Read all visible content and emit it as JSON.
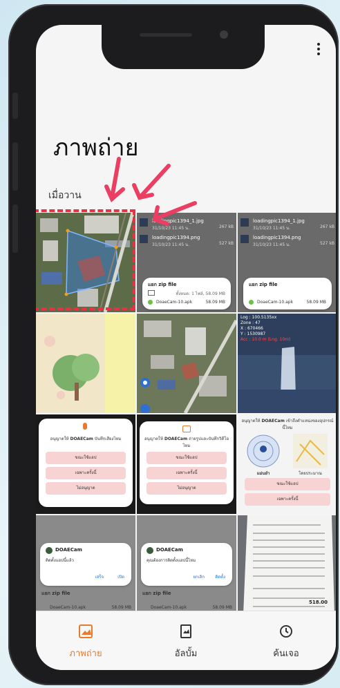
{
  "app": {
    "title": "ภาพถ่าย",
    "section_label": "เมื่อวาน",
    "accent_color": "#e87a2e",
    "highlight_color": "#e53345"
  },
  "grid": {
    "tile2": {
      "files": [
        {
          "name": "loadingpic1394_1.jpg",
          "date": "31/10/23 11:45 น.",
          "size": "267 kB"
        },
        {
          "name": "loadingpic1394.png",
          "date": "31/10/23 11:45 น.",
          "size": "527 kB"
        }
      ],
      "sheet_title": "แยก zip file",
      "sheet_meta": "ทั้งหมด: 1 ไฟล์, 58.09 MB",
      "apk_name": "DoaeCam-10.apk",
      "apk_size": "58.09 MB"
    },
    "tile3": {
      "files": [
        {
          "name": "loadingpic1394_1.jpg",
          "date": "31/10/23 11:45 น.",
          "size": "267 kB"
        },
        {
          "name": "loadingpic1394.png",
          "date": "31/10/23 11:45 น.",
          "size": "527 kB"
        }
      ],
      "sheet_title": "แยก zip file",
      "apk_name": "DoaeCam-10.apk",
      "apk_size": "58.09 MB"
    },
    "tile6": {
      "overlay_line1": "Log : 100.5135xx",
      "overlay_line2": "Zone : 47",
      "overlay_line3": "X : 670466",
      "overlay_line4": "Y : 1530987",
      "overlay_line5": "Acc : 10.0 m (Lng. 10m)"
    },
    "tile7": {
      "prompt_prefix": "อนุญาตให้",
      "prompt_app": "DOAECam",
      "prompt_suffix": "บันทึกเสียงไหม",
      "btn1": "ขณะใช้แอป",
      "btn2": "เฉพาะครั้งนี้",
      "btn3": "ไม่อนุญาต"
    },
    "tile8": {
      "prompt_prefix": "อนุญาตให้",
      "prompt_app": "DOAECam",
      "prompt_suffix": "ถ่ายรูปและบันทึกวิดีโอไหม",
      "btn1": "ขณะใช้แอป",
      "btn2": "เฉพาะครั้งนี้",
      "btn3": "ไม่อนุญาต"
    },
    "tile9": {
      "prompt_prefix": "อนุญาตให้",
      "prompt_app": "DOAECam",
      "prompt_suffix": "เข้าถึงตำแหน่งของอุปกรณ์นี้ไหม",
      "precise": "แม่นยำ",
      "approx": "โดยประมาณ",
      "btn1": "ขณะใช้แอป",
      "btn2": "เฉพาะครั้งนี้"
    },
    "tile10": {
      "app_name": "DOAECam",
      "message": "ติดตั้งแอปนี้แล้ว",
      "action1": "เสร็จ",
      "action2": "เปิด",
      "sheet_title": "แยก zip file",
      "apk_name": "DoaeCam-10.apk",
      "apk_size": "58.09 MB"
    },
    "tile11": {
      "app_name": "DOAECam",
      "message": "คุณต้องการติดตั้งแอปนี้ไหม",
      "action1": "ยกเลิก",
      "action2": "ติดตั้ง",
      "sheet_title": "แยก zip file",
      "apk_name": "DoaeCam-10.apk",
      "apk_size": "58.09 MB"
    },
    "tile12": {
      "receipt_total": "518.00"
    }
  },
  "nav": {
    "photos": "ภาพถ่าย",
    "albums": "อัลบั้ม",
    "search": "ค้นเจอ"
  }
}
